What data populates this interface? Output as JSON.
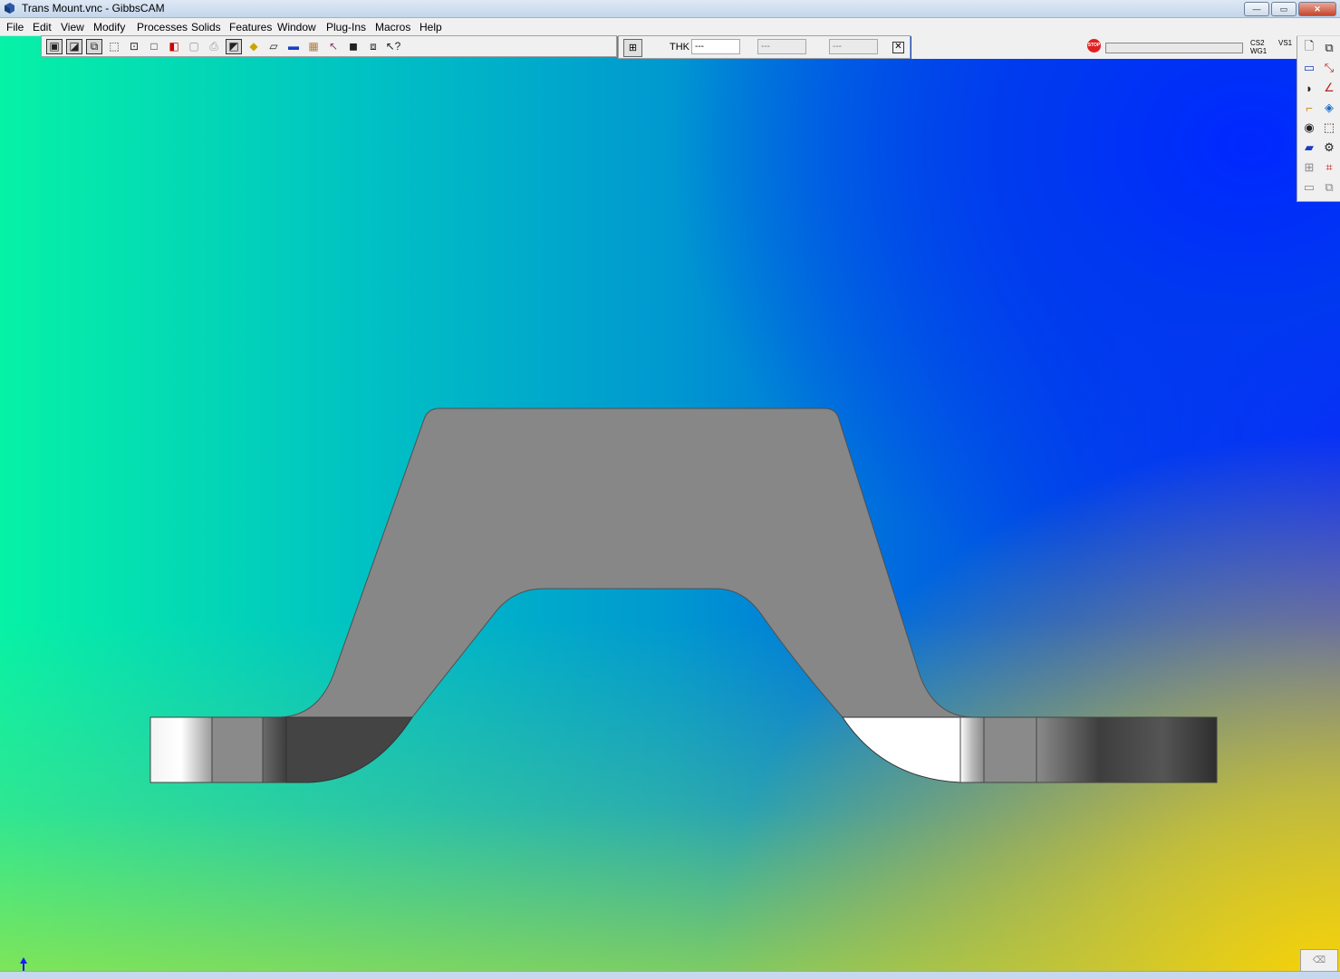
{
  "window": {
    "title": "Trans Mount.vnc - GibbsCAM",
    "controls": {
      "minimize": "—",
      "maximize": "▭",
      "close": "✕"
    }
  },
  "menu": [
    "File",
    "Edit",
    "View",
    "Modify",
    "Processes",
    "Solids",
    "Features",
    "Window",
    "Plug-Ins",
    "Macros",
    "Help"
  ],
  "toolbar": {
    "icons": [
      "wireframe-view-icon",
      "hidden-line-view-icon",
      "shaded-view-icon",
      "box-solid-icon",
      "point-icon",
      "square-icon",
      "color-palette-icon",
      "grey-box-icon",
      "print-icon",
      "select-solid-icon",
      "cube-yellow-icon",
      "plane-icon",
      "tool-icon",
      "stock-icon",
      "pointer-icon",
      "tile-icon",
      "layers-icon",
      "help-pointer-icon"
    ]
  },
  "thickness_bar": {
    "label": "THK",
    "value1": "---",
    "value2": "---",
    "value3": "---"
  },
  "status": {
    "stop_label": "STOP",
    "progress": 0,
    "cs": "CS2",
    "wg": "WG1",
    "vs": "VS1"
  },
  "right_palette": [
    "new-doc-icon",
    "copy-doc-icon",
    "rectangle-icon",
    "axis-arrows-icon",
    "curve-icon",
    "angle-icon",
    "pipe-icon",
    "surface-icon",
    "eye-icon",
    "cube-icon",
    "slab-icon",
    "gear-view-icon",
    "grid-select-icon",
    "frame-select-icon",
    "flat-icon",
    "stack-icon"
  ],
  "colors": {
    "part_grey": "#878787",
    "background_teal": "#00c0c4",
    "background_blue": "#0028ff",
    "background_yellow": "#ffd400"
  }
}
